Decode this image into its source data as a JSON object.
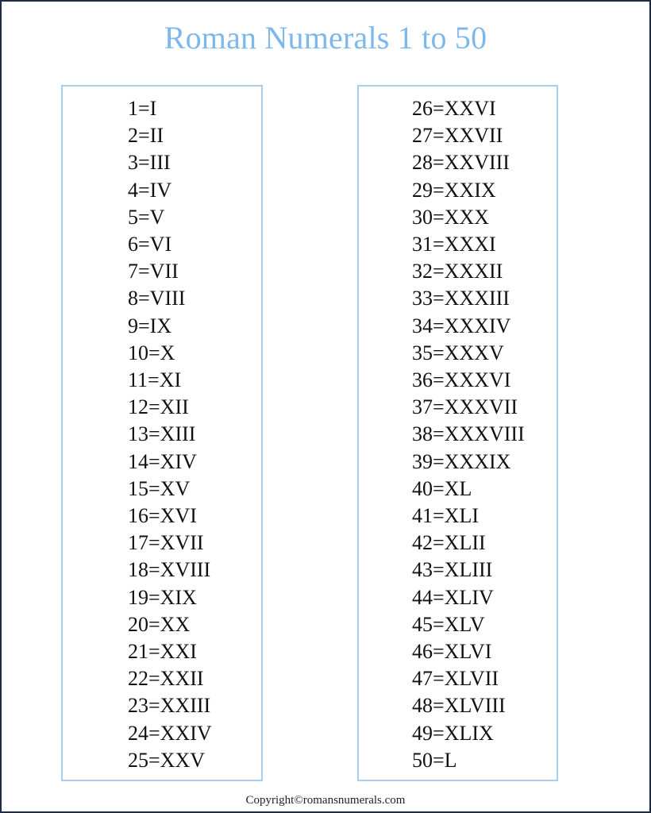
{
  "title": "Roman Numerals 1 to 50",
  "left_column": [
    "1=I",
    "2=II",
    "3=III",
    "4=IV",
    "5=V",
    "6=VI",
    "7=VII",
    "8=VIII",
    "9=IX",
    "10=X",
    "11=XI",
    "12=XII",
    "13=XIII",
    "14=XIV",
    "15=XV",
    "16=XVI",
    "17=XVII",
    "18=XVIII",
    "19=XIX",
    "20=XX",
    "21=XXI",
    "22=XXII",
    "23=XXIII",
    "24=XXIV",
    "25=XXV"
  ],
  "right_column": [
    "26=XXVI",
    "27=XXVII",
    "28=XXVIII",
    "29=XXIX",
    "30=XXX",
    "31=XXXI",
    "32=XXXII",
    "33=XXXIII",
    "34=XXXIV",
    "35=XXXV",
    "36=XXXVI",
    "37=XXXVII",
    "38=XXXVIII",
    "39=XXXIX",
    "40=XL",
    "41=XLI",
    "42=XLII",
    "43=XLIII",
    "44=XLIV",
    "45=XLV",
    "46=XLVI",
    "47=XLVII",
    "48=XLVIII",
    "49=XLIX",
    "50=L"
  ],
  "footer": "Copyright©romansnumerals.com",
  "colors": {
    "title": "#7cb8ec",
    "box_border": "#a9cdee",
    "frame_border": "#1f2a44"
  }
}
